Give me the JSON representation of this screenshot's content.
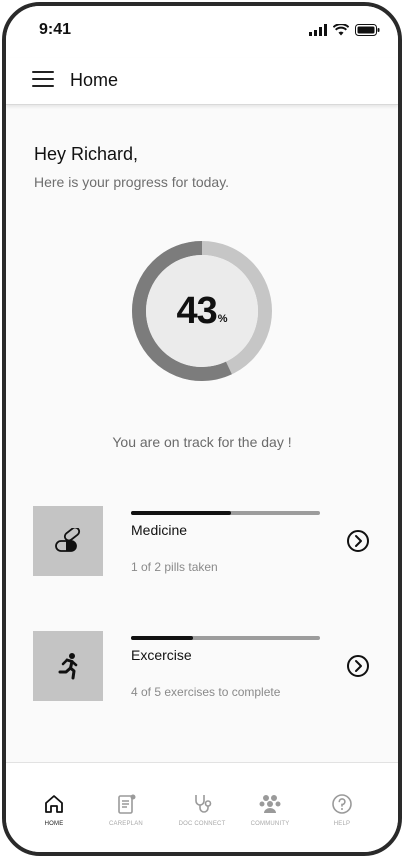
{
  "status_bar": {
    "time": "9:41"
  },
  "header": {
    "title": "Home"
  },
  "greeting": {
    "title": "Hey Richard,",
    "subtitle": "Here is your progress for today."
  },
  "progress": {
    "value": "43",
    "unit": "%",
    "fraction": 0.43,
    "status": "You are on track for the day !"
  },
  "cards": [
    {
      "title": "Medicine",
      "subtitle": "1 of 2 pills taken",
      "progress": 0.53,
      "icon": "pill-icon"
    },
    {
      "title": "Excercise",
      "subtitle": "4 of 5 exercises to complete",
      "progress": 0.33,
      "icon": "running-icon"
    }
  ],
  "tabs": [
    {
      "label": "HOME",
      "icon": "home-icon",
      "active": true
    },
    {
      "label": "CAREPLAN",
      "icon": "careplan-icon",
      "active": false
    },
    {
      "label": "DOC CONNECT",
      "icon": "stethoscope-icon",
      "active": false
    },
    {
      "label": "COMMUNITY",
      "icon": "community-icon",
      "active": false
    },
    {
      "label": "HELP",
      "icon": "help-icon",
      "active": false
    }
  ],
  "colors": {
    "track_light": "#c6c6c6",
    "track_dark": "#7c7c7c",
    "inner": "#ebebeb",
    "thumb": "#c4c4c4"
  }
}
